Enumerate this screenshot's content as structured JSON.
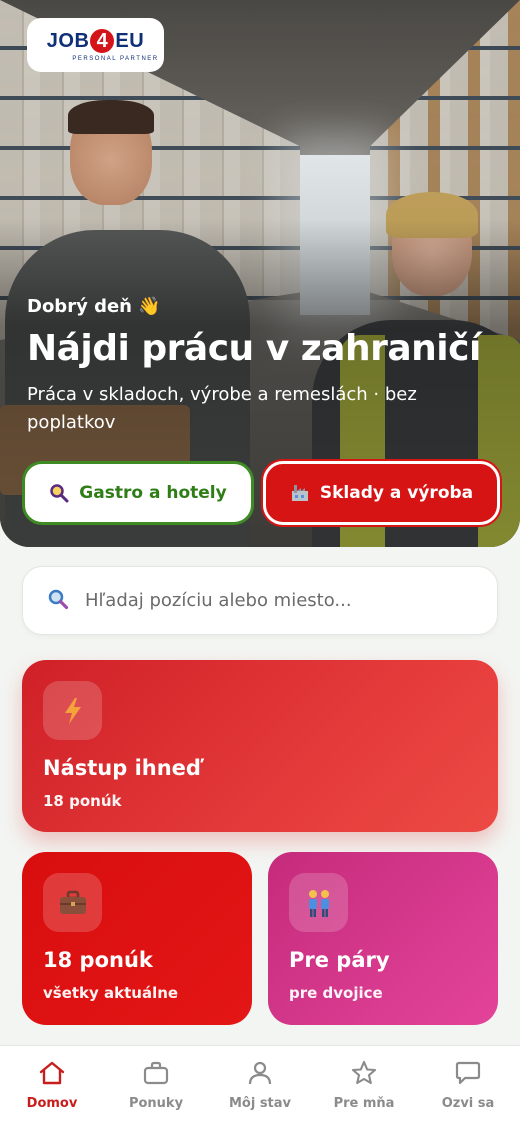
{
  "brand": {
    "logo_text_pre": "JOB",
    "logo_text_num": "4",
    "logo_text_post": "EU",
    "logo_tagline": "PERSONAL PARTNER",
    "primary_color": "#d71414",
    "navy_color": "#0f2f77",
    "green_color": "#3e8a23"
  },
  "hero": {
    "greeting": "Dobrý deň 👋",
    "headline": "Nájdi prácu v zahraničí",
    "subline": "Práca v skladoch, výrobe a remeslách · bez poplatkov",
    "buttons": [
      {
        "label": "Gastro a hotely",
        "icon": "magnifier-icon"
      },
      {
        "label": "Sklady a výroba",
        "icon": "factory-icon"
      }
    ]
  },
  "search": {
    "placeholder": "Hľadaj pozíciu alebo miesto...",
    "value": "",
    "icon": "search-icon"
  },
  "cards": {
    "immediate": {
      "title": "Nástup ihneď",
      "subtitle": "18 ponúk",
      "icon": "lightning-icon"
    },
    "all_offers": {
      "title": "18 ponúk",
      "subtitle": "všetky aktuálne",
      "icon": "briefcase-icon"
    },
    "pairs": {
      "title": "Pre páry",
      "subtitle": "pre dvojice",
      "icon": "couple-icon"
    }
  },
  "bottom_nav": {
    "active": "Domov",
    "items": [
      {
        "label": "Domov",
        "icon": "home-icon"
      },
      {
        "label": "Ponuky",
        "icon": "briefcase-icon"
      },
      {
        "label": "Môj stav",
        "icon": "person-icon"
      },
      {
        "label": "Pre mňa",
        "icon": "star-icon"
      },
      {
        "label": "Ozvi sa",
        "icon": "chat-icon"
      }
    ]
  }
}
